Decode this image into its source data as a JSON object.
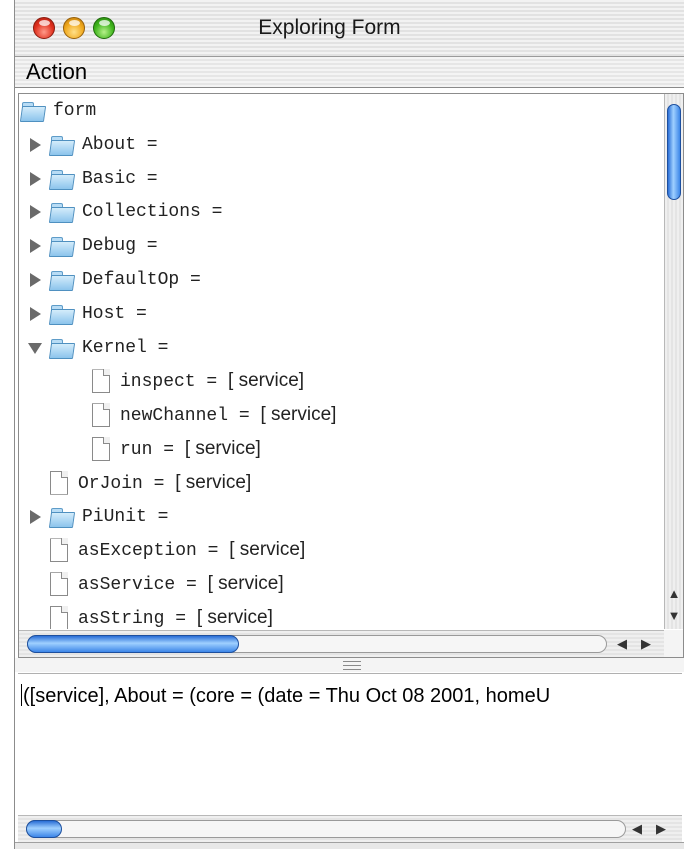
{
  "window": {
    "title": "Exploring Form"
  },
  "menubar": {
    "items": [
      "Action"
    ]
  },
  "tree": {
    "rows": [
      {
        "label": "form",
        "kind": "folder",
        "disclosure": "none",
        "indent": 0
      },
      {
        "label": "About =",
        "kind": "folder",
        "disclosure": "collapsed",
        "indent": 1
      },
      {
        "label": "Basic =",
        "kind": "folder",
        "disclosure": "collapsed",
        "indent": 1
      },
      {
        "label": "Collections =",
        "kind": "folder",
        "disclosure": "collapsed",
        "indent": 1
      },
      {
        "label": "Debug =",
        "kind": "folder",
        "disclosure": "collapsed",
        "indent": 1
      },
      {
        "label": "DefaultOp =",
        "kind": "folder",
        "disclosure": "collapsed",
        "indent": 1
      },
      {
        "label": "Host =",
        "kind": "folder",
        "disclosure": "collapsed",
        "indent": 1
      },
      {
        "label": "Kernel =",
        "kind": "folder",
        "disclosure": "expanded",
        "indent": 1
      },
      {
        "label": "inspect = ",
        "service": "[ service]",
        "kind": "doc",
        "disclosure": "none",
        "indent": 2
      },
      {
        "label": "newChannel = ",
        "service": "[ service]",
        "kind": "doc",
        "disclosure": "none",
        "indent": 2
      },
      {
        "label": "run = ",
        "service": "[ service]",
        "kind": "doc",
        "disclosure": "none",
        "indent": 2
      },
      {
        "label": "OrJoin = ",
        "service": "[ service]",
        "kind": "doc",
        "disclosure": "none",
        "indent": 1
      },
      {
        "label": "PiUnit =",
        "kind": "folder",
        "disclosure": "collapsed",
        "indent": 1
      },
      {
        "label": "asException = ",
        "service": "[ service]",
        "kind": "doc",
        "disclosure": "none",
        "indent": 1
      },
      {
        "label": "asService = ",
        "service": "[ service]",
        "kind": "doc",
        "disclosure": "none",
        "indent": 1
      },
      {
        "label": "asString = ",
        "service": "[ service]",
        "kind": "doc",
        "disclosure": "none",
        "indent": 1
      }
    ]
  },
  "output": {
    "text": "([service], About = (core = (date = Thu Oct 08 2001, homeU"
  },
  "colors": {
    "scroll_thumb": "#3c86e8",
    "close": "#e0301e",
    "minimize": "#f0a81c",
    "zoom": "#3fb51c"
  },
  "icons": {
    "folder": "folder-icon",
    "document": "document-icon",
    "collapsed": "disclosure-triangle-right-icon",
    "expanded": "disclosure-triangle-down-icon"
  }
}
